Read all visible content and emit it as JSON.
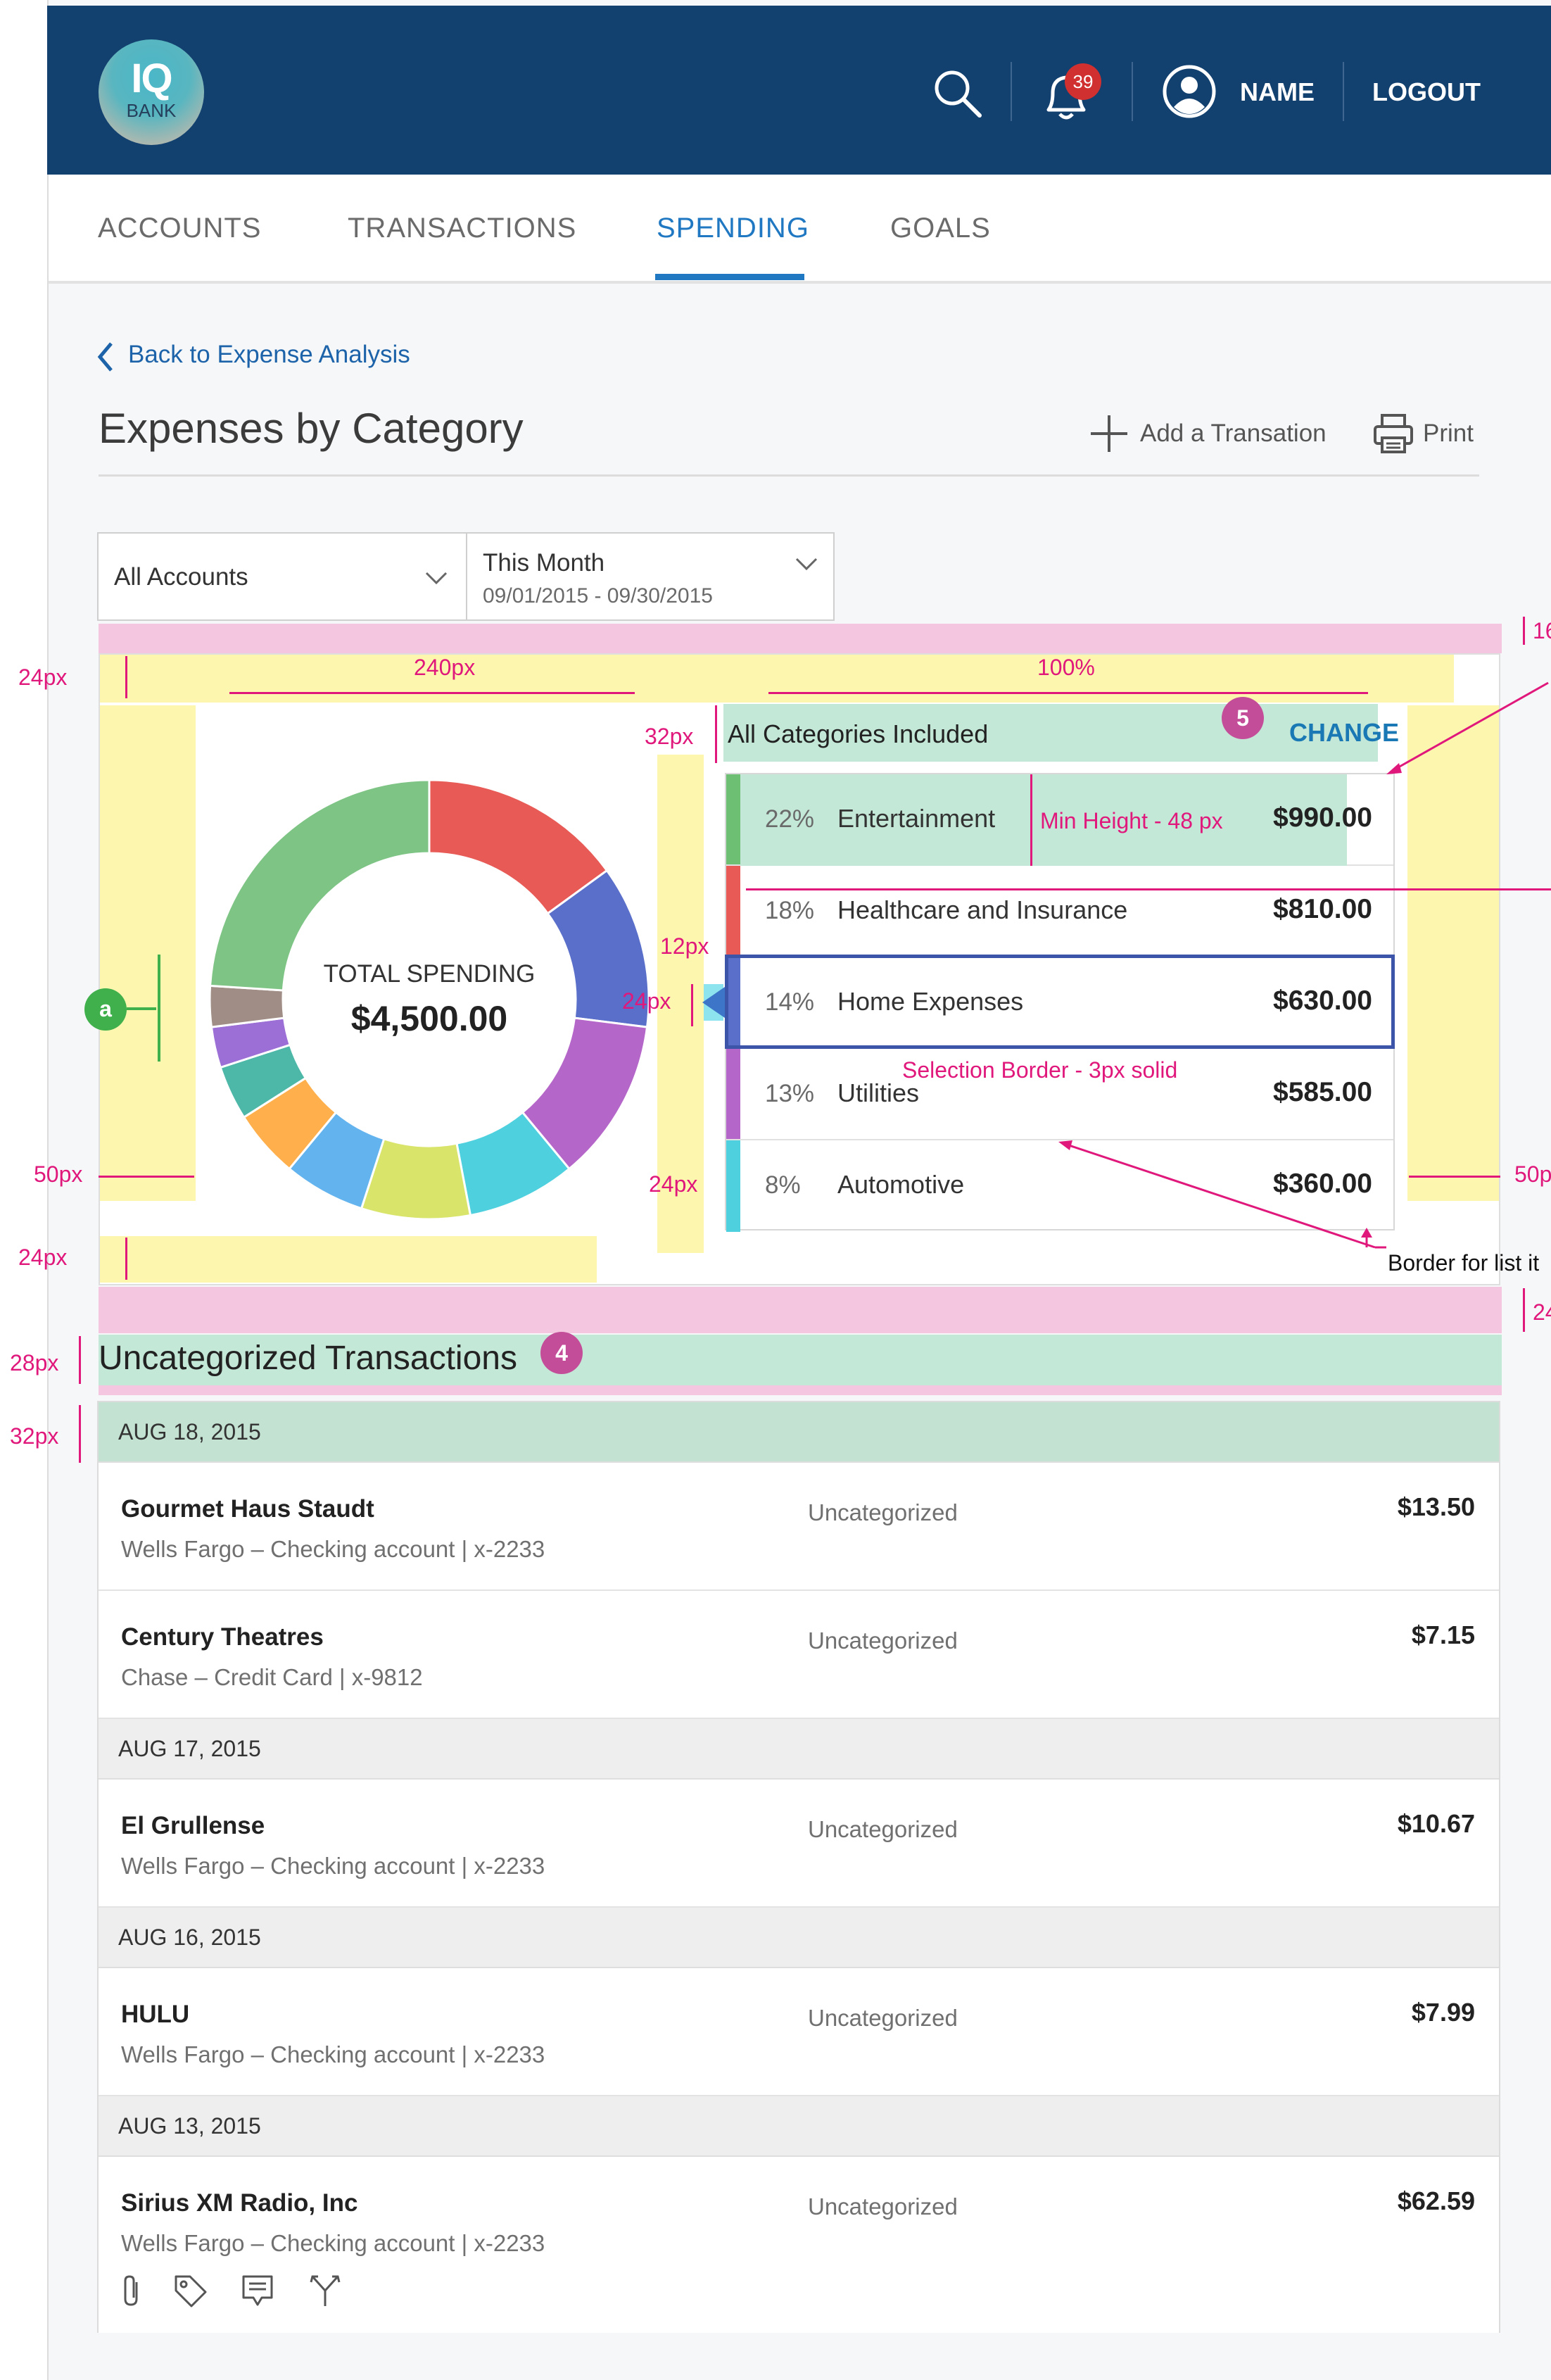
{
  "header": {
    "logo_main": "IQ",
    "logo_sub": "BANK",
    "notification_count": "39",
    "user_name": "NAME",
    "logout": "LOGOUT"
  },
  "nav": {
    "tabs": [
      {
        "label": "ACCOUNTS"
      },
      {
        "label": "TRANSACTIONS"
      },
      {
        "label": "SPENDING"
      },
      {
        "label": "GOALS"
      }
    ],
    "active": "SPENDING"
  },
  "page": {
    "back_link": "Back to Expense Analysis",
    "title": "Expenses by Category",
    "add_transaction": "Add a Transation",
    "print": "Print"
  },
  "filters": {
    "account": "All Accounts",
    "period": "This Month",
    "period_range": "09/01/2015 - 09/30/2015"
  },
  "chart": {
    "center_label": "TOTAL SPENDING",
    "center_value": "$4,500.00",
    "list_header": "All Categories Included",
    "change": "CHANGE"
  },
  "chart_data": {
    "type": "pie",
    "variant": "donut",
    "categories": [
      "Entertainment",
      "Healthcare and Insurance",
      "Home Expenses",
      "Utilities",
      "Automotive"
    ],
    "values": [
      22,
      18,
      14,
      13,
      8
    ],
    "amounts": [
      "$990.00",
      "$810.00",
      "$630.00",
      "$585.00",
      "$360.00"
    ],
    "percent_labels": [
      "22%",
      "18%",
      "14%",
      "13%",
      "8%"
    ],
    "colors": [
      "#6cbf73",
      "#e85a55",
      "#5a6fc9",
      "#b566c9",
      "#4fd0de"
    ],
    "donut_segments": [
      {
        "color": "#e85a55",
        "value": 15
      },
      {
        "color": "#5a6fc9",
        "value": 12
      },
      {
        "color": "#b566c9",
        "value": 12
      },
      {
        "color": "#4fd0de",
        "value": 8
      },
      {
        "color": "#d9e46b",
        "value": 8
      },
      {
        "color": "#63b3ef",
        "value": 6
      },
      {
        "color": "#ffb04d",
        "value": 5
      },
      {
        "color": "#4db8a8",
        "value": 4
      },
      {
        "color": "#9b6fd6",
        "value": 3
      },
      {
        "color": "#a08e86",
        "value": 3
      },
      {
        "color": "#7ec485",
        "value": 24
      }
    ],
    "selected": "Home Expenses"
  },
  "annotations": {
    "px24_a": "24px",
    "px240": "240px",
    "pct100": "100%",
    "px32_a": "32px",
    "px12": "12px",
    "px24_b": "24px",
    "px24_c": "24px",
    "px50_a": "50px",
    "px50_b": "50p",
    "px24_d": "24px",
    "px28": "28px",
    "px32_b": "32px",
    "px16": "16",
    "px24_e": "24",
    "min_height": "Min Height - 48 px",
    "selection_border": "Selection Border - 3px solid",
    "border_list": "Border for list it",
    "badge_a": "a",
    "badge_5": "5",
    "badge_4": "4"
  },
  "uncategorized": {
    "title": "Uncategorized Transactions",
    "groups": [
      {
        "date": "AUG 18, 2015",
        "items": [
          {
            "name": "Gourmet Haus Staudt",
            "account": "Wells Fargo – Checking account | x-2233",
            "category": "Uncategorized",
            "amount": "$13.50"
          },
          {
            "name": "Century Theatres",
            "account": "Chase – Credit Card | x-9812",
            "category": "Uncategorized",
            "amount": "$7.15"
          }
        ]
      },
      {
        "date": "AUG 17, 2015",
        "items": [
          {
            "name": "El Grullense",
            "account": "Wells Fargo – Checking account | x-2233",
            "category": "Uncategorized",
            "amount": "$10.67"
          }
        ]
      },
      {
        "date": "AUG 16, 2015",
        "items": [
          {
            "name": "HULU",
            "account": "Wells Fargo – Checking account | x-2233",
            "category": "Uncategorized",
            "amount": "$7.99"
          }
        ]
      },
      {
        "date": "AUG 13, 2015",
        "items": [
          {
            "name": "Sirius XM Radio, Inc",
            "account": "Wells Fargo – Checking account | x-2233",
            "category": "Uncategorized",
            "amount": "$62.59"
          }
        ]
      }
    ]
  },
  "icons": [
    "search-icon",
    "bell-icon",
    "user-icon",
    "chevron-left-icon",
    "plus-icon",
    "printer-icon",
    "chevron-down-icon",
    "paperclip-icon",
    "tag-icon",
    "note-icon",
    "split-icon"
  ]
}
